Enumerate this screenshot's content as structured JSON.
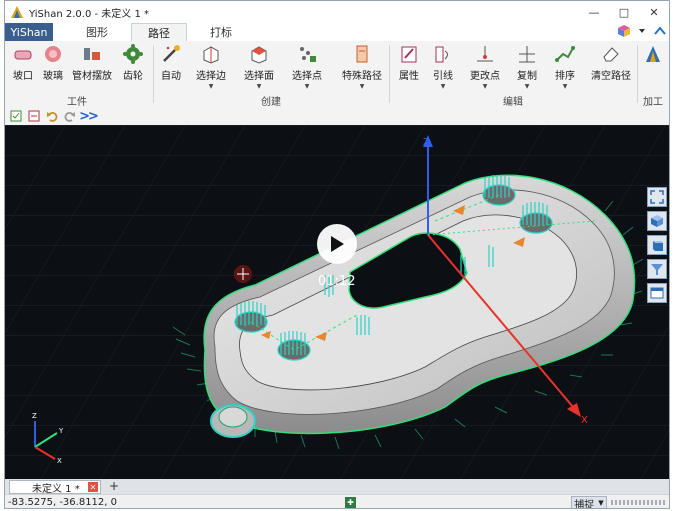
{
  "window": {
    "title": "YiShan 2.0.0 - 未定义 1 *",
    "controls": {
      "minimize": "—",
      "maximize": "□",
      "close": "✕"
    }
  },
  "tabs": {
    "app_label": "YiShan",
    "items": [
      {
        "label": "图形",
        "active": false
      },
      {
        "label": "路径",
        "active": true
      },
      {
        "label": "打标",
        "active": false
      }
    ]
  },
  "ribbon": {
    "groups": [
      {
        "label": "工件",
        "buttons": [
          "坡口",
          "玻璃",
          "管材摆放",
          "齿轮"
        ]
      },
      {
        "label": "创建",
        "buttons": [
          "自动",
          "选择边",
          "选择面",
          "选择点",
          "特殊路径"
        ]
      },
      {
        "label": "编辑",
        "buttons": [
          "属性",
          "引线",
          "更改点",
          "复制",
          "排序",
          "清空路径"
        ]
      },
      {
        "label": "加工",
        "buttons": []
      }
    ]
  },
  "quickbar": {
    "more_label": ">>"
  },
  "viewport": {
    "video_time": "01:12",
    "axis_labels": {
      "z": "Z",
      "x": "X",
      "small_z": "Z",
      "small_y": "Y",
      "small_x": "X"
    }
  },
  "document_tab": {
    "label": "未定义 1 *",
    "close": "✕",
    "add": "+"
  },
  "status": {
    "coords": "-83.5275, -36.8112, 0",
    "snap_label": "捕捉"
  },
  "colors": {
    "accent": "#3a5f8e",
    "viewport_bg": "#0c0f14",
    "path_green": "#2fe07a",
    "teal": "#2bd3c4"
  }
}
